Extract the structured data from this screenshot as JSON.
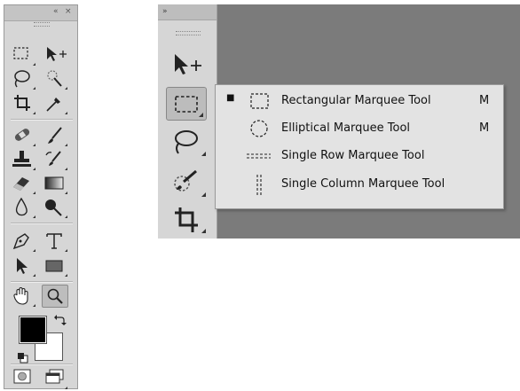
{
  "toolbox": {
    "header_collapse": "«",
    "header_close": "×",
    "foreground_color": "#000000",
    "background_color": "#ffffff"
  },
  "zoomed_panel": {
    "collapse_glyph": "»"
  },
  "flyout": {
    "items": [
      {
        "label": "Rectangular Marquee Tool",
        "shortcut": "M",
        "selected_mark": "■"
      },
      {
        "label": "Elliptical Marquee Tool",
        "shortcut": "M",
        "selected_mark": ""
      },
      {
        "label": "Single Row Marquee Tool",
        "shortcut": "",
        "selected_mark": ""
      },
      {
        "label": "Single Column Marquee Tool",
        "shortcut": "",
        "selected_mark": ""
      }
    ]
  },
  "colors": {
    "panel": "#d6d6d6",
    "canvas": "#7b7b7b",
    "flyout": "#e3e3e3"
  }
}
